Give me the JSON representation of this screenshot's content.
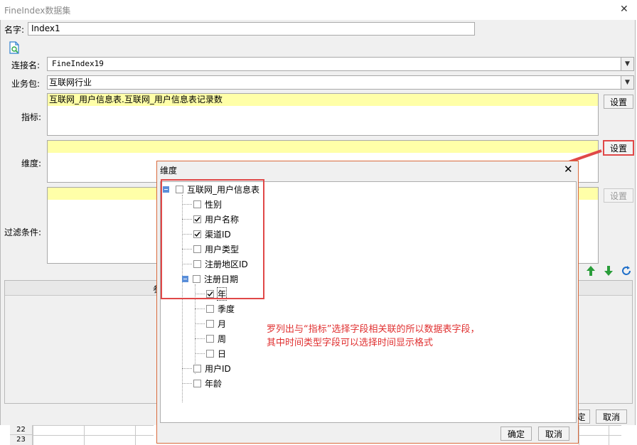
{
  "window": {
    "title": "FineIndex数据集"
  },
  "form": {
    "name_label": "名字:",
    "name_value": "Index1",
    "connection_label": "连接名:",
    "connection_value": "FineIndex19",
    "package_label": "业务包:",
    "package_value": "互联网行业",
    "metric_label": "指标:",
    "metric_value": "互联网_用户信息表.互联网_用户信息表记录数",
    "dimension_label": "维度:",
    "filter_label": "过滤条件:",
    "settings_label": "设置"
  },
  "background": {
    "rows": [
      "22",
      "23"
    ],
    "confirm_partial": "定",
    "cancel_label": "取消",
    "column_header_partial": "参"
  },
  "popup": {
    "title": "维度",
    "tree": {
      "root": "互联网_用户信息表",
      "items": [
        {
          "label": "性别",
          "checked": false
        },
        {
          "label": "用户名称",
          "checked": true
        },
        {
          "label": "渠道ID",
          "checked": true
        },
        {
          "label": "用户类型",
          "checked": false
        },
        {
          "label": "注册地区ID",
          "checked": false
        },
        {
          "label": "注册日期",
          "checked": false
        },
        {
          "label": "年",
          "checked": true
        },
        {
          "label": "季度",
          "checked": false
        },
        {
          "label": "月",
          "checked": false
        },
        {
          "label": "周",
          "checked": false
        },
        {
          "label": "日",
          "checked": false
        },
        {
          "label": "用户ID",
          "checked": false
        },
        {
          "label": "年龄",
          "checked": false
        }
      ]
    },
    "confirm_label": "确定",
    "cancel_label": "取消"
  },
  "annotation": {
    "line1": "罗列出与“指标”选择字段相关联的所以数据表字段，",
    "line2": "其中时间类型字段可以选择时间显示格式",
    "color": "#e03030"
  },
  "icons": {
    "preview": "document-search-icon",
    "move_up": "arrow-up-icon",
    "move_down": "arrow-down-icon",
    "refresh": "refresh-icon",
    "combo": "chevron-down-icon",
    "close": "close-icon"
  },
  "colors": {
    "highlight": "#ffffa8",
    "accent": "#e04848",
    "green": "#2a9d3a",
    "blue": "#1f6fc9"
  }
}
